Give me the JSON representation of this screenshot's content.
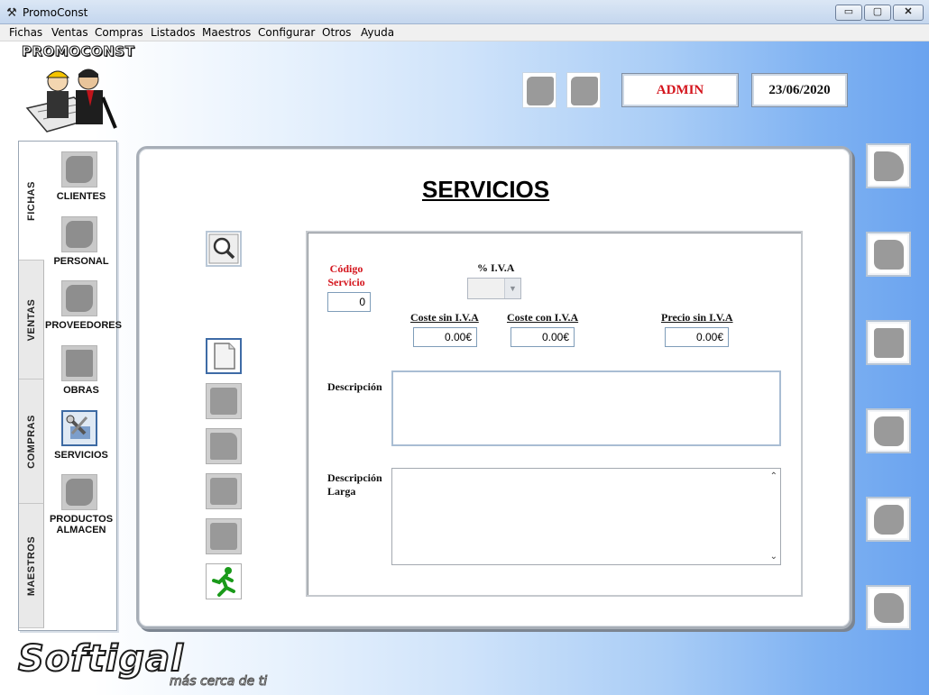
{
  "window": {
    "title": "PromoConst",
    "minimize": "▭",
    "maximize": "▢",
    "close": "✕"
  },
  "menu": [
    "Fichas",
    "Ventas",
    "Compras",
    "Listados",
    "Maestros",
    "Configurar",
    "Otros",
    "Ayuda"
  ],
  "header": {
    "logo": "PROMOCONST",
    "user": "ADMIN",
    "date": "23/06/2020"
  },
  "tabs": [
    "FICHAS",
    "VENTAS",
    "COMPRAS",
    "MAESTROS"
  ],
  "nav": [
    "CLIENTES",
    "PERSONAL",
    "PROVEEDORES",
    "OBRAS",
    "SERVICIOS",
    "PRODUCTOS ALMACEN"
  ],
  "main": {
    "title": "SERVICIOS",
    "labels": {
      "codigo": "Código Servicio",
      "iva": "% I.V.A",
      "coste_sin": "Coste sin I.V.A",
      "coste_con": "Coste con I.V.A",
      "precio_sin": "Precio sin I.V.A",
      "descripcion": "Descripción",
      "descripcion_larga": "Descripción Larga"
    },
    "values": {
      "codigo": "0",
      "iva": "",
      "coste_sin": "0.00€",
      "coste_con": "0.00€",
      "precio_sin": "0.00€"
    },
    "scroll": {
      "up": "⌃",
      "down": "⌄"
    }
  },
  "footer": {
    "brand": "Softigal",
    "tagline": "más cerca de ti"
  }
}
